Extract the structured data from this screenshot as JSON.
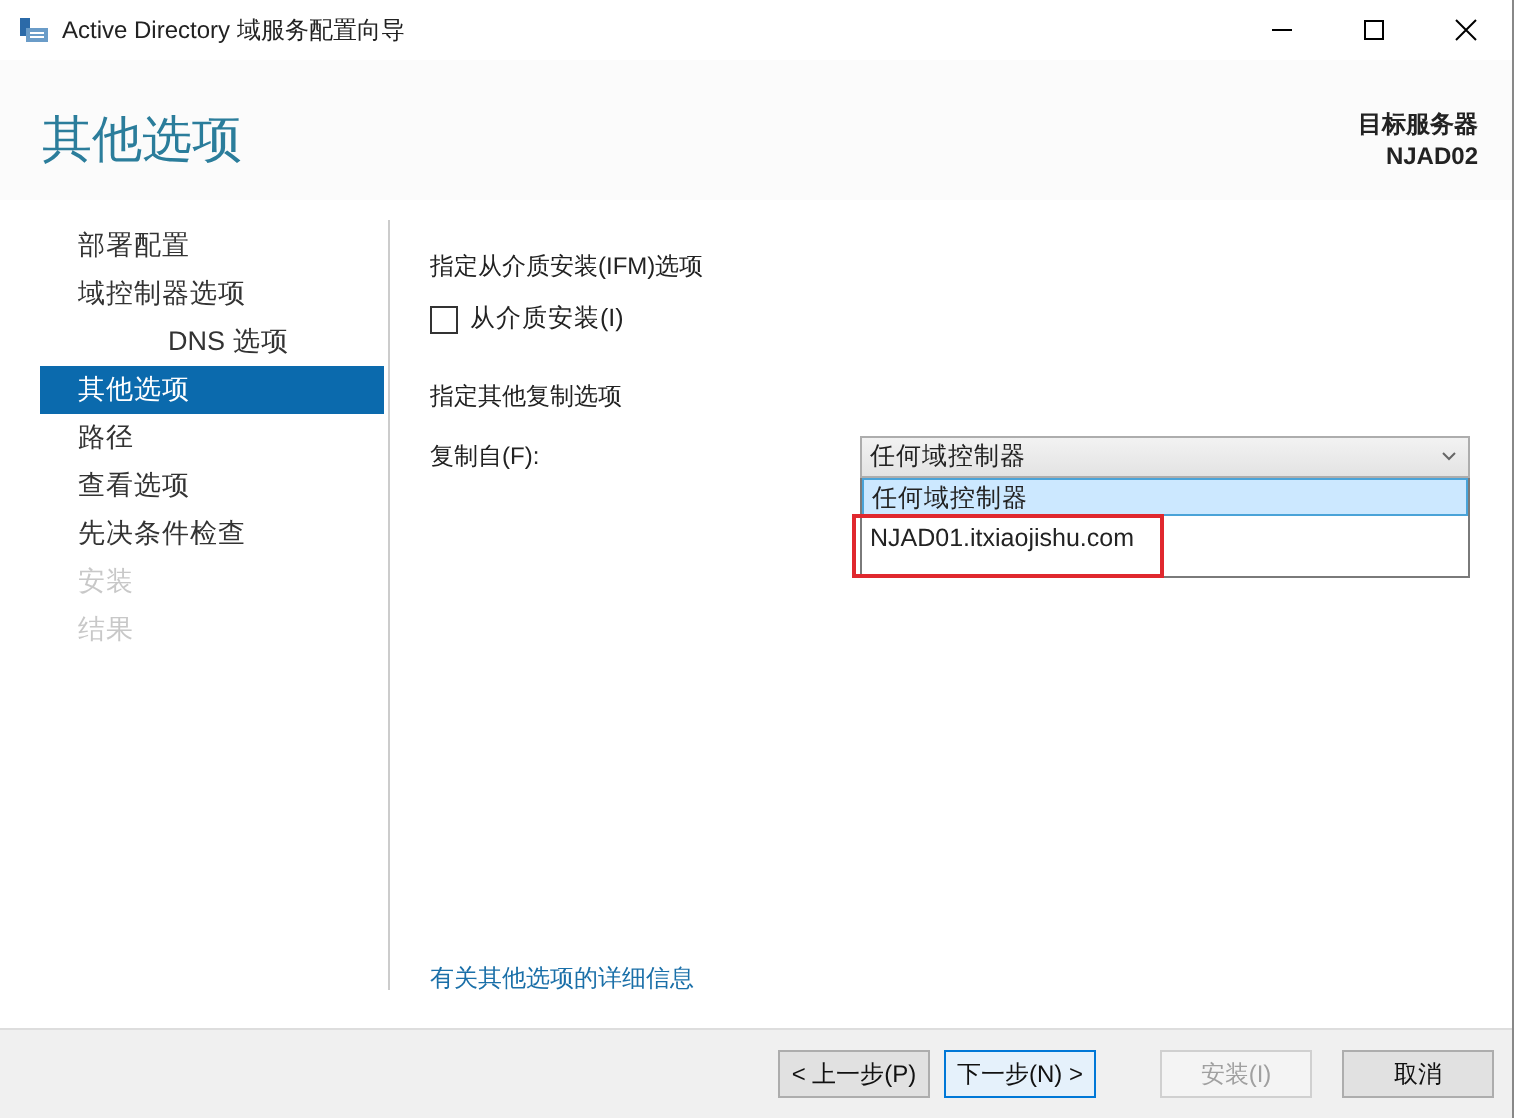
{
  "window": {
    "title": "Active Directory 域服务配置向导"
  },
  "header": {
    "page_title": "其他选项",
    "target_label": "目标服务器",
    "target_server": "NJAD02"
  },
  "sidebar": {
    "items": [
      {
        "label": "部署配置",
        "selected": false,
        "disabled": false
      },
      {
        "label": "域控制器选项",
        "selected": false,
        "disabled": false,
        "children": [
          {
            "label": "DNS 选项",
            "selected": false,
            "disabled": false
          }
        ]
      },
      {
        "label": "其他选项",
        "selected": true,
        "disabled": false
      },
      {
        "label": "路径",
        "selected": false,
        "disabled": false
      },
      {
        "label": "查看选项",
        "selected": false,
        "disabled": false
      },
      {
        "label": "先决条件检查",
        "selected": false,
        "disabled": false
      },
      {
        "label": "安装",
        "selected": false,
        "disabled": true
      },
      {
        "label": "结果",
        "selected": false,
        "disabled": true
      }
    ]
  },
  "ifm": {
    "heading": "指定从介质安装(IFM)选项",
    "checkbox": {
      "label": "从介质安装(I)",
      "checked": false
    }
  },
  "replication": {
    "heading": "指定其他复制选项",
    "label": "复制自(F):",
    "dropdown": {
      "value": "任何域控制器",
      "expanded": true,
      "options": [
        {
          "label": "任何域控制器",
          "selected": true,
          "highlighted": false
        },
        {
          "label": "NJAD01.itxiaojishu.com",
          "selected": false,
          "highlighted": true
        }
      ]
    }
  },
  "more_info_link": "有关其他选项的详细信息",
  "buttons": [
    {
      "label": "< 上一步(P)",
      "disabled": false,
      "focused": false
    },
    {
      "label": "下一步(N) >",
      "disabled": false,
      "focused": true
    },
    {
      "label": "安装(I)",
      "disabled": true,
      "focused": false
    },
    {
      "label": "取消",
      "disabled": false,
      "focused": false
    }
  ]
}
